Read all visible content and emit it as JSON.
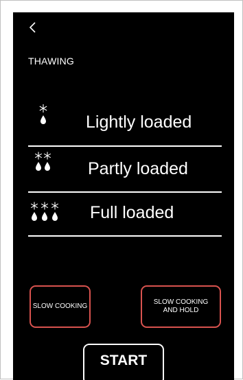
{
  "header": {
    "back_icon": "chevron-left-icon",
    "title": "THAWING"
  },
  "load_options": [
    {
      "label": "Lightly loaded",
      "icon": "snowflake-drop-icon",
      "count": 1
    },
    {
      "label": "Partly loaded",
      "icon": "snowflake-drop-icon",
      "count": 2
    },
    {
      "label": "Full loaded",
      "icon": "snowflake-drop-icon",
      "count": 3
    }
  ],
  "modes": {
    "slow_cooking": "SLOW COOKING",
    "slow_cooking_hold_line1": "SLOW COOKING",
    "slow_cooking_hold_line2": "AND HOLD"
  },
  "start": {
    "label": "START"
  },
  "colors": {
    "screen_bg": "#000000",
    "text": "#ffffff",
    "mode_border": "#d9534f"
  }
}
